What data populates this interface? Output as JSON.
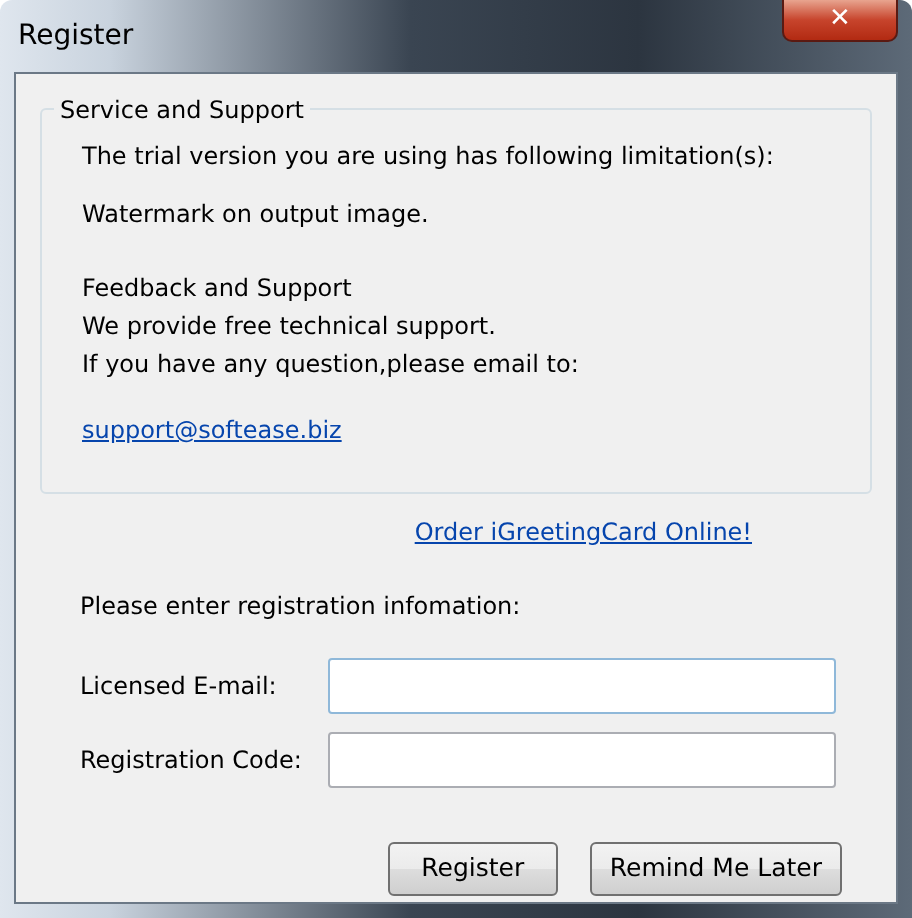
{
  "window": {
    "title": "Register",
    "close_label": "✕"
  },
  "group": {
    "title": "Service and Support",
    "lines": [
      "The trial version you are using has following limitation(s):",
      "Watermark on output image.",
      "Feedback and Support",
      "We provide free technical support.",
      "If you have any question,please email to:"
    ],
    "email_link": "support@softease.biz"
  },
  "order_link": "Order iGreetingCard Online!",
  "prompt": "Please enter registration infomation:",
  "fields": [
    {
      "label": "Licensed E-mail:",
      "focused": true
    },
    {
      "label": "Registration Code:",
      "focused": false
    }
  ],
  "buttons": [
    {
      "label": "Register"
    },
    {
      "label": "Remind Me Later"
    }
  ]
}
